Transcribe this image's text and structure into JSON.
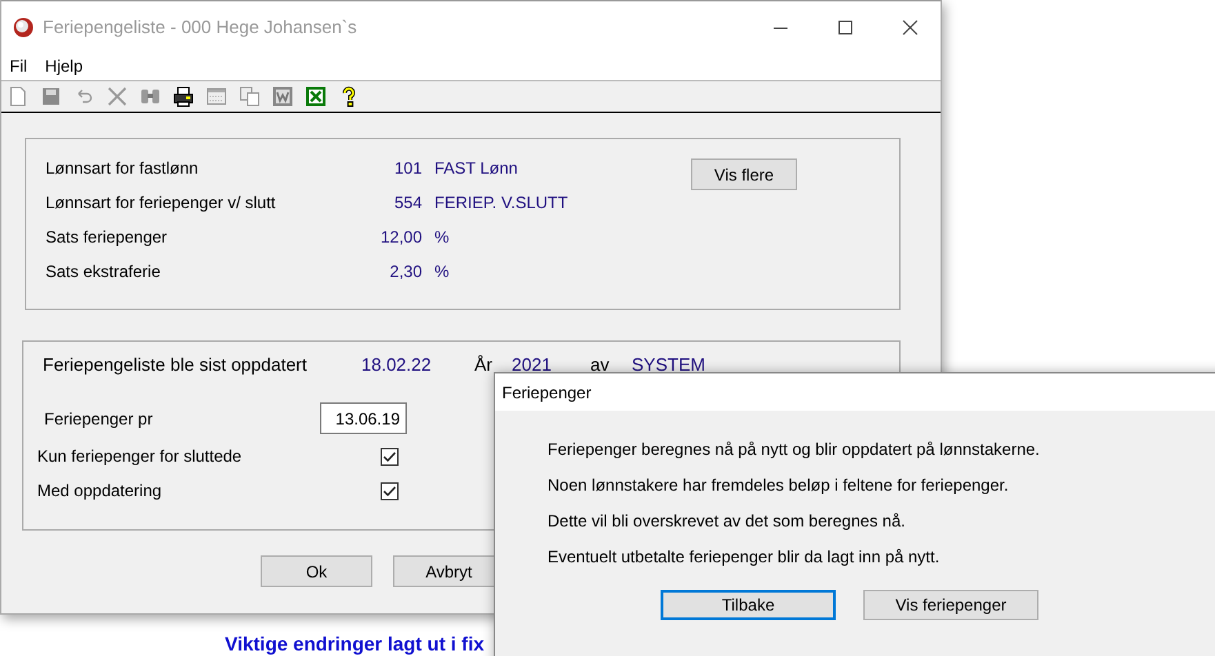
{
  "background_links": [
    "Viktige endringer lagt ut i fix"
  ],
  "window": {
    "title": "Feriepengeliste - 000 Hege Johansen`s",
    "menu": [
      "Fil",
      "Hjelp"
    ],
    "toolbar": [
      {
        "kind": "new"
      },
      {
        "kind": "save"
      },
      {
        "kind": "undo"
      },
      {
        "kind": "delete"
      },
      {
        "kind": "find"
      },
      {
        "kind": "print"
      },
      {
        "kind": "calendar"
      },
      {
        "kind": "copy"
      },
      {
        "kind": "word"
      },
      {
        "kind": "excel"
      },
      {
        "kind": "help"
      }
    ],
    "settings": [
      {
        "label": "Lønnsart for fastlønn",
        "value": "101",
        "text": "FAST Lønn"
      },
      {
        "label": "Lønnsart for feriepenger v/ slutt",
        "value": "554",
        "text": "FERIEP. V.SLUTT"
      },
      {
        "label": "Sats feriepenger",
        "value": "12,00",
        "text": "%"
      },
      {
        "label": "Sats ekstraferie",
        "value": "2,30",
        "text": "%"
      }
    ],
    "more_button": "Vis flere",
    "updated": {
      "label": "Feriepengeliste ble sist oppdatert",
      "date": "18.02.22",
      "year_label": "År",
      "year": "2021",
      "by_label": "av",
      "by": "SYSTEM"
    },
    "date_field": {
      "label": "Feriepenger pr",
      "value": "13.06.19"
    },
    "checkboxes": [
      {
        "label": "Kun feriepenger for sluttede",
        "checked": true
      },
      {
        "label": "Med oppdatering",
        "checked": true
      }
    ],
    "buttons": [
      "Ok",
      "Avbryt"
    ]
  },
  "dialog": {
    "title": "Feriepenger",
    "lines": [
      "Feriepenger beregnes nå på nytt og blir oppdatert på lønnstakerne.",
      "Noen lønnstakere har fremdeles beløp i feltene for feriepenger.",
      "Dette vil bli overskrevet av det som beregnes nå.",
      "Eventuelt utbetalte feriepenger blir da lagt inn på nytt."
    ],
    "buttons": [
      {
        "label": "Tilbake",
        "focused": true
      },
      {
        "label": "Vis feriepenger",
        "focused": false
      }
    ]
  }
}
